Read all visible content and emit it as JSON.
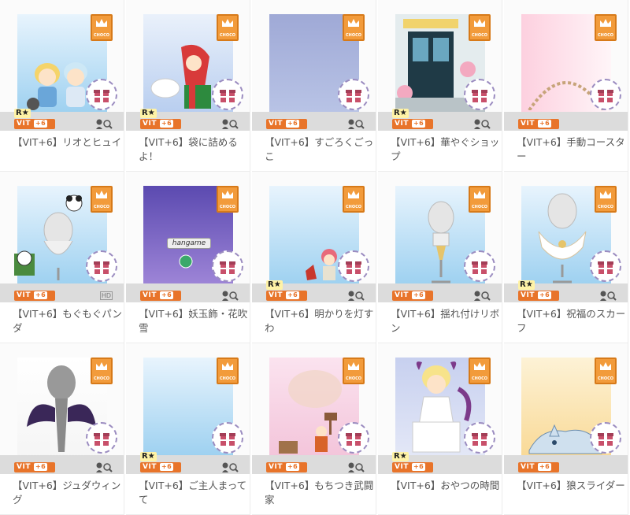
{
  "choco_label": "CHOCO",
  "vit_label": "VIT",
  "vit_plus": "+6",
  "rank_label": "R★",
  "items": [
    {
      "title": "【VIT+6】リオとヒュイ"
    },
    {
      "title": "【VIT+6】袋に詰めるよ！"
    },
    {
      "title": "【VIT+6】すごろくごっこ"
    },
    {
      "title": "【VIT+6】華やぐショップ"
    },
    {
      "title": "【VIT+6】手動コースター"
    },
    {
      "title": "【VIT+6】もぐもぐパンダ"
    },
    {
      "title": "【VIT+6】妖玉飾・花吹雪"
    },
    {
      "title": "【VIT+6】明かりを灯すわ"
    },
    {
      "title": "【VIT+6】揺れ付けリボン"
    },
    {
      "title": "【VIT+6】祝福のスカーフ"
    },
    {
      "title": "【VIT+6】ジュダウィング"
    },
    {
      "title": "【VIT+6】ご主人まってて"
    },
    {
      "title": "【VIT+6】もちつき武闘家"
    },
    {
      "title": "【VIT+6】おやつの時間"
    },
    {
      "title": "【VIT+6】狼スライダー"
    }
  ],
  "promo_text": "hangame",
  "hd_badge": "HD",
  "colors": {
    "accent": "#e8742a",
    "choco": "#f29b3b",
    "gift_ribbon": "#c8506a"
  }
}
